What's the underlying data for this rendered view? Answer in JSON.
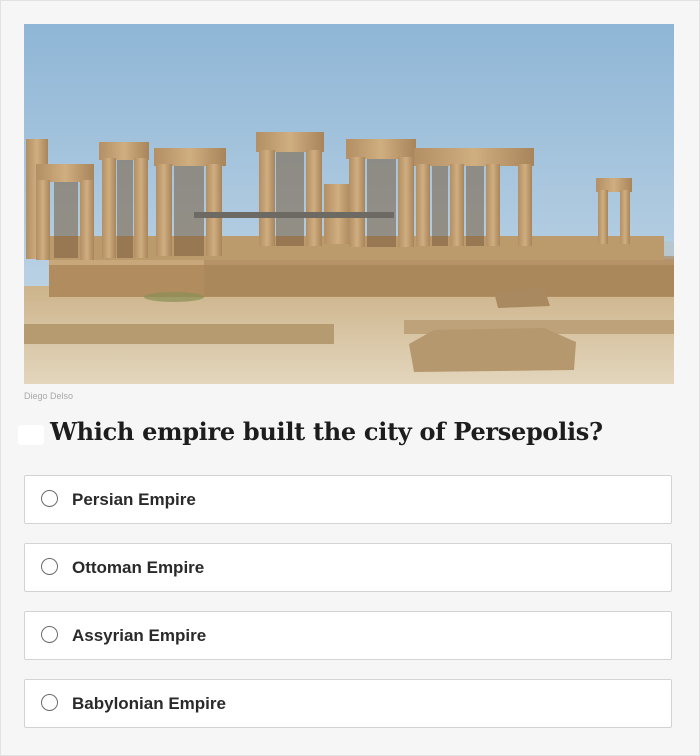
{
  "photo": {
    "alt": "Ruins of Persepolis",
    "credit": "Diego Delso"
  },
  "quiz": {
    "question": "Which empire built the city of Persepolis?",
    "options": [
      {
        "label": "Persian Empire"
      },
      {
        "label": "Ottoman Empire"
      },
      {
        "label": "Assyrian Empire"
      },
      {
        "label": "Babylonian Empire"
      }
    ]
  },
  "colors": {
    "sky": "#9fc1dc",
    "stone": "#c3a47a",
    "ground": "#d8c7a4",
    "text": "#1d1d1d",
    "border": "#d3d3d3"
  }
}
